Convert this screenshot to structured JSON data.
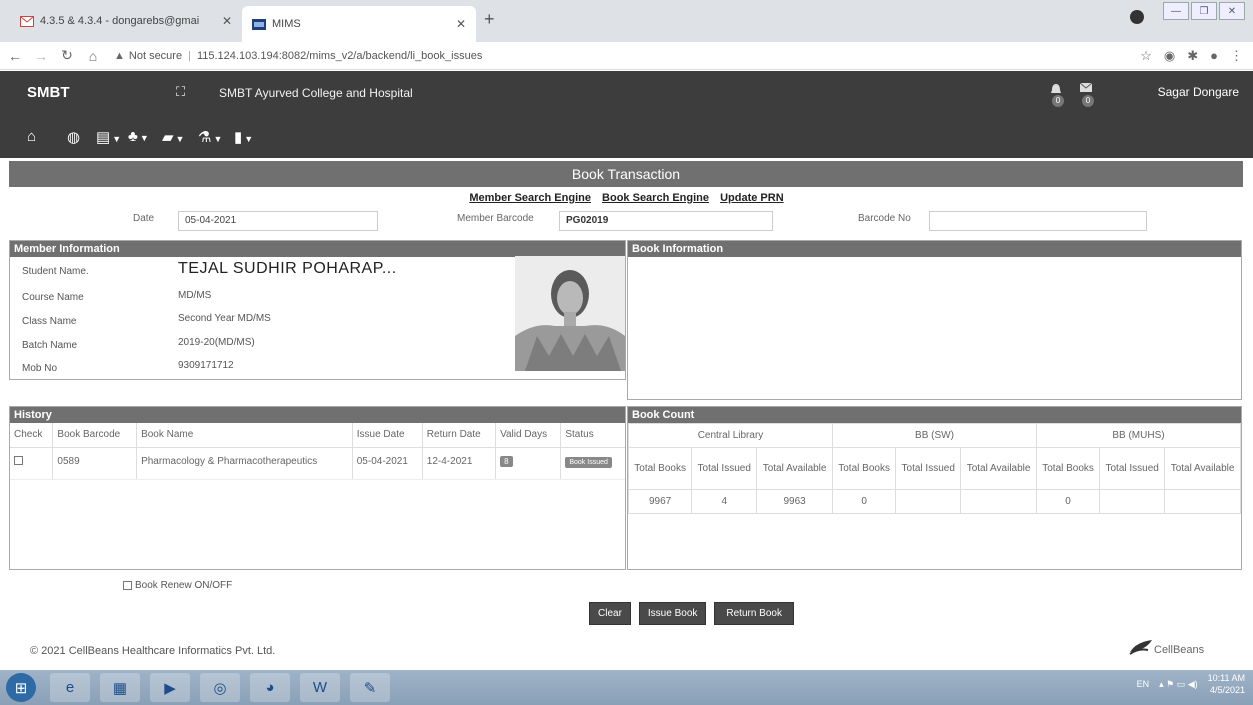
{
  "browser": {
    "tabs": [
      {
        "title": "4.3.5 & 4.3.4 - dongarebs@gmai",
        "active": false
      },
      {
        "title": "MIMS",
        "active": true
      }
    ],
    "url_warning": "Not secure",
    "url": "115.124.103.194:8082/mims_v2/a/backend/li_book_issues"
  },
  "header": {
    "brand": "SMBT",
    "college": "SMBT Ayurved College and Hospital",
    "notifications_count": "0",
    "messages_count": "0",
    "user": "Sagar Dongare"
  },
  "page": {
    "title": "Book Transaction",
    "links": [
      "Member Search Engine",
      "Book Search Engine",
      "Update PRN"
    ],
    "date_label": "Date",
    "date_value": "05-04-2021",
    "member_barcode_label": "Member Barcode",
    "member_barcode_value": "PG02019",
    "barcode_no_label": "Barcode No",
    "barcode_no_value": ""
  },
  "member": {
    "heading": "Member Information",
    "student_label": "Student Name.",
    "student_value": "TEJAL SUDHIR POHARAP...",
    "course_label": "Course Name",
    "course_value": "MD/MS",
    "class_label": "Class Name",
    "class_value": "Second Year MD/MS",
    "batch_label": "Batch Name",
    "batch_value": "2019-20(MD/MS)",
    "mob_label": "Mob No",
    "mob_value": "9309171712"
  },
  "book_info": {
    "heading": "Book Information"
  },
  "history": {
    "heading": "History",
    "columns": [
      "Check",
      "Book Barcode",
      "Book Name",
      "Issue Date",
      "Return Date",
      "Valid Days",
      "Status"
    ],
    "rows": [
      {
        "barcode": "0589",
        "name": "Pharmacology & Pharmacotherapeutics",
        "issue": "05-04-2021",
        "return": "12-4-2021",
        "valid": "8",
        "status": "Book Issued"
      }
    ]
  },
  "book_count": {
    "heading": "Book Count",
    "groups": [
      "Central Library",
      "BB (SW)",
      "BB (MUHS)"
    ],
    "sub": [
      "Total Books",
      "Total Issued",
      "Total Available"
    ],
    "values": [
      [
        "9967",
        "4",
        "9963"
      ],
      [
        "0",
        "",
        ""
      ],
      [
        "0",
        "",
        ""
      ]
    ]
  },
  "renew_label": "Book Renew ON/OFF",
  "buttons": {
    "clear": "Clear",
    "issue": "Issue Book",
    "return": "Return Book"
  },
  "footer": "© 2021 CellBeans Healthcare Informatics Pvt. Ltd.",
  "footer_logo": "CellBeans",
  "taskbar": {
    "lang": "EN",
    "time": "10:11 AM",
    "date": "4/5/2021"
  }
}
